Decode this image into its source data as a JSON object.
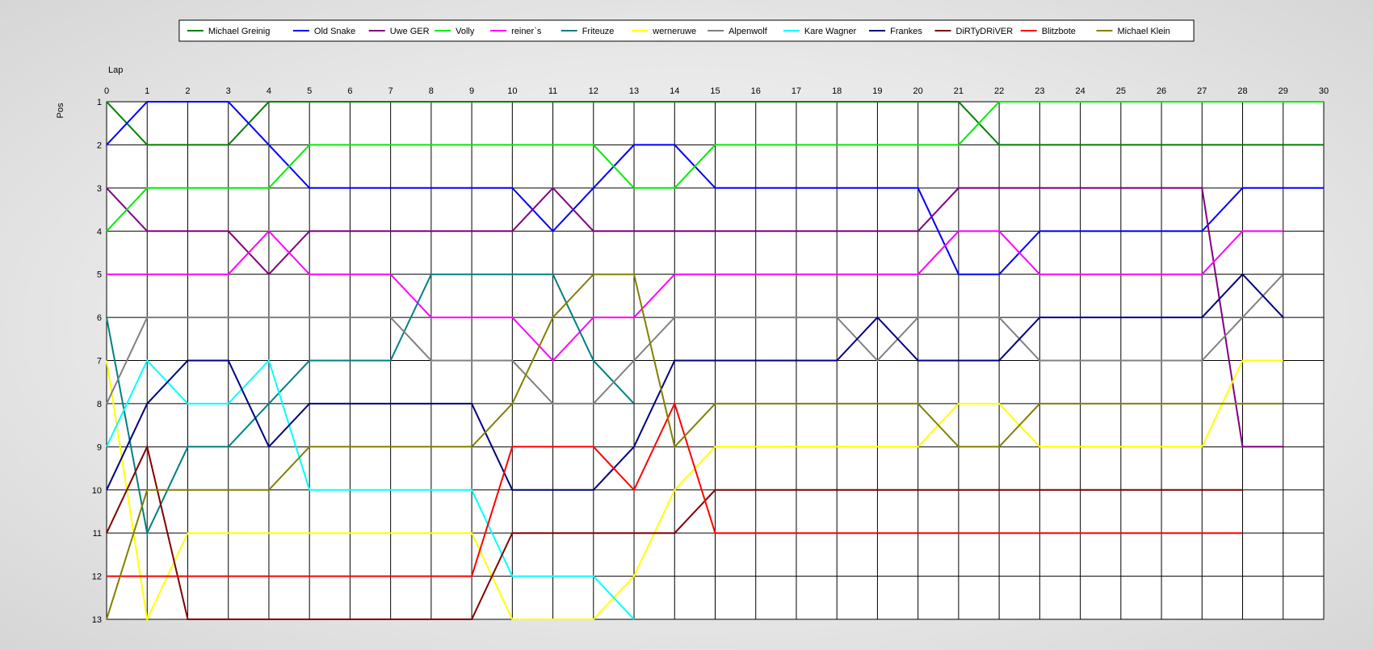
{
  "chart_data": {
    "type": "line",
    "xlabel": "Lap",
    "ylabel": "Pos",
    "xlim": [
      0,
      30
    ],
    "ylim": [
      13,
      1
    ],
    "y_inverted": true,
    "grid": true,
    "legend_position": "top-center",
    "x": [
      0,
      1,
      2,
      3,
      4,
      5,
      6,
      7,
      8,
      9,
      10,
      11,
      12,
      13,
      14,
      15,
      16,
      17,
      18,
      19,
      20,
      21,
      22,
      23,
      24,
      25,
      26,
      27,
      28,
      29,
      30
    ],
    "x_ticks": [
      "0",
      "1",
      "2",
      "3",
      "4",
      "5",
      "6",
      "7",
      "8",
      "9",
      "10",
      "11",
      "12",
      "13",
      "14",
      "15",
      "16",
      "17",
      "18",
      "19",
      "20",
      "21",
      "22",
      "23",
      "24",
      "25",
      "26",
      "27",
      "28",
      "29",
      "30"
    ],
    "y_ticks": [
      "1",
      "2",
      "3",
      "4",
      "5",
      "6",
      "7",
      "8",
      "9",
      "10",
      "11",
      "12",
      "13"
    ],
    "series": [
      {
        "name": "Michael Greinig",
        "color": "#008000",
        "values": [
          1,
          2,
          2,
          2,
          1,
          1,
          1,
          1,
          1,
          1,
          1,
          1,
          1,
          1,
          1,
          1,
          1,
          1,
          1,
          1,
          1,
          1,
          2,
          2,
          2,
          2,
          2,
          2,
          2,
          2,
          2
        ]
      },
      {
        "name": "Old Snake",
        "color": "#0000ff",
        "values": [
          2,
          1,
          1,
          1,
          2,
          3,
          3,
          3,
          3,
          3,
          3,
          4,
          3,
          2,
          2,
          3,
          3,
          3,
          3,
          3,
          3,
          5,
          5,
          4,
          4,
          4,
          4,
          4,
          3,
          3,
          3
        ]
      },
      {
        "name": "Uwe GER",
        "color": "#800080",
        "values": [
          3,
          4,
          4,
          4,
          5,
          4,
          4,
          4,
          4,
          4,
          4,
          3,
          4,
          4,
          4,
          4,
          4,
          4,
          4,
          4,
          4,
          3,
          3,
          3,
          3,
          3,
          3,
          3,
          9,
          9
        ]
      },
      {
        "name": "Volly",
        "color": "#00ee00",
        "values": [
          4,
          3,
          3,
          3,
          3,
          2,
          2,
          2,
          2,
          2,
          2,
          2,
          2,
          3,
          3,
          2,
          2,
          2,
          2,
          2,
          2,
          2,
          1,
          1,
          1,
          1,
          1,
          1,
          1,
          1,
          1
        ]
      },
      {
        "name": "reiner`s",
        "color": "#ff00ff",
        "values": [
          5,
          5,
          5,
          5,
          4,
          5,
          5,
          5,
          6,
          6,
          6,
          7,
          6,
          6,
          5,
          5,
          5,
          5,
          5,
          5,
          5,
          4,
          4,
          5,
          5,
          5,
          5,
          5,
          4,
          4
        ]
      },
      {
        "name": "Friteuze",
        "color": "#008080",
        "values": [
          6,
          11,
          9,
          9,
          8,
          7,
          7,
          7,
          5,
          5,
          5,
          5,
          7,
          8
        ]
      },
      {
        "name": "werneruwe",
        "color": "#ffff00",
        "values": [
          7,
          13,
          11,
          11,
          11,
          11,
          11,
          11,
          11,
          11,
          13,
          13,
          13,
          12,
          10,
          9,
          9,
          9,
          9,
          9,
          9,
          8,
          8,
          9,
          9,
          9,
          9,
          9,
          7,
          7
        ]
      },
      {
        "name": "Alpenwolf",
        "color": "#808080",
        "values": [
          8,
          6,
          6,
          6,
          6,
          6,
          6,
          6,
          7,
          7,
          7,
          8,
          8,
          7,
          6,
          6,
          6,
          6,
          6,
          7,
          6,
          6,
          6,
          7,
          7,
          7,
          7,
          7,
          6,
          5
        ]
      },
      {
        "name": "Kare Wagner",
        "color": "#00ffff",
        "values": [
          9,
          7,
          8,
          8,
          7,
          10,
          10,
          10,
          10,
          10,
          12,
          12,
          12,
          13
        ]
      },
      {
        "name": "Frankes",
        "color": "#000080",
        "values": [
          10,
          8,
          7,
          7,
          9,
          8,
          8,
          8,
          8,
          8,
          10,
          10,
          10,
          9,
          7,
          7,
          7,
          7,
          7,
          6,
          7,
          7,
          7,
          6,
          6,
          6,
          6,
          6,
          5,
          6
        ]
      },
      {
        "name": "DiRTyDRiVER",
        "color": "#800000",
        "values": [
          11,
          9,
          13,
          13,
          13,
          13,
          13,
          13,
          13,
          13,
          11,
          11,
          11,
          11,
          11,
          10,
          10,
          10,
          10,
          10,
          10,
          10,
          10,
          10,
          10,
          10,
          10,
          10,
          10
        ]
      },
      {
        "name": "Blitzbote",
        "color": "#ff0000",
        "values": [
          12,
          12,
          12,
          12,
          12,
          12,
          12,
          12,
          12,
          12,
          9,
          9,
          9,
          10,
          8,
          11,
          11,
          11,
          11,
          11,
          11,
          11,
          11,
          11,
          11,
          11,
          11,
          11,
          11
        ]
      },
      {
        "name": "Michael Klein",
        "color": "#808000",
        "values": [
          13,
          10,
          10,
          10,
          10,
          9,
          9,
          9,
          9,
          9,
          8,
          6,
          5,
          5,
          9,
          8,
          8,
          8,
          8,
          8,
          8,
          9,
          9,
          8,
          8,
          8,
          8,
          8,
          8,
          8
        ]
      }
    ]
  }
}
